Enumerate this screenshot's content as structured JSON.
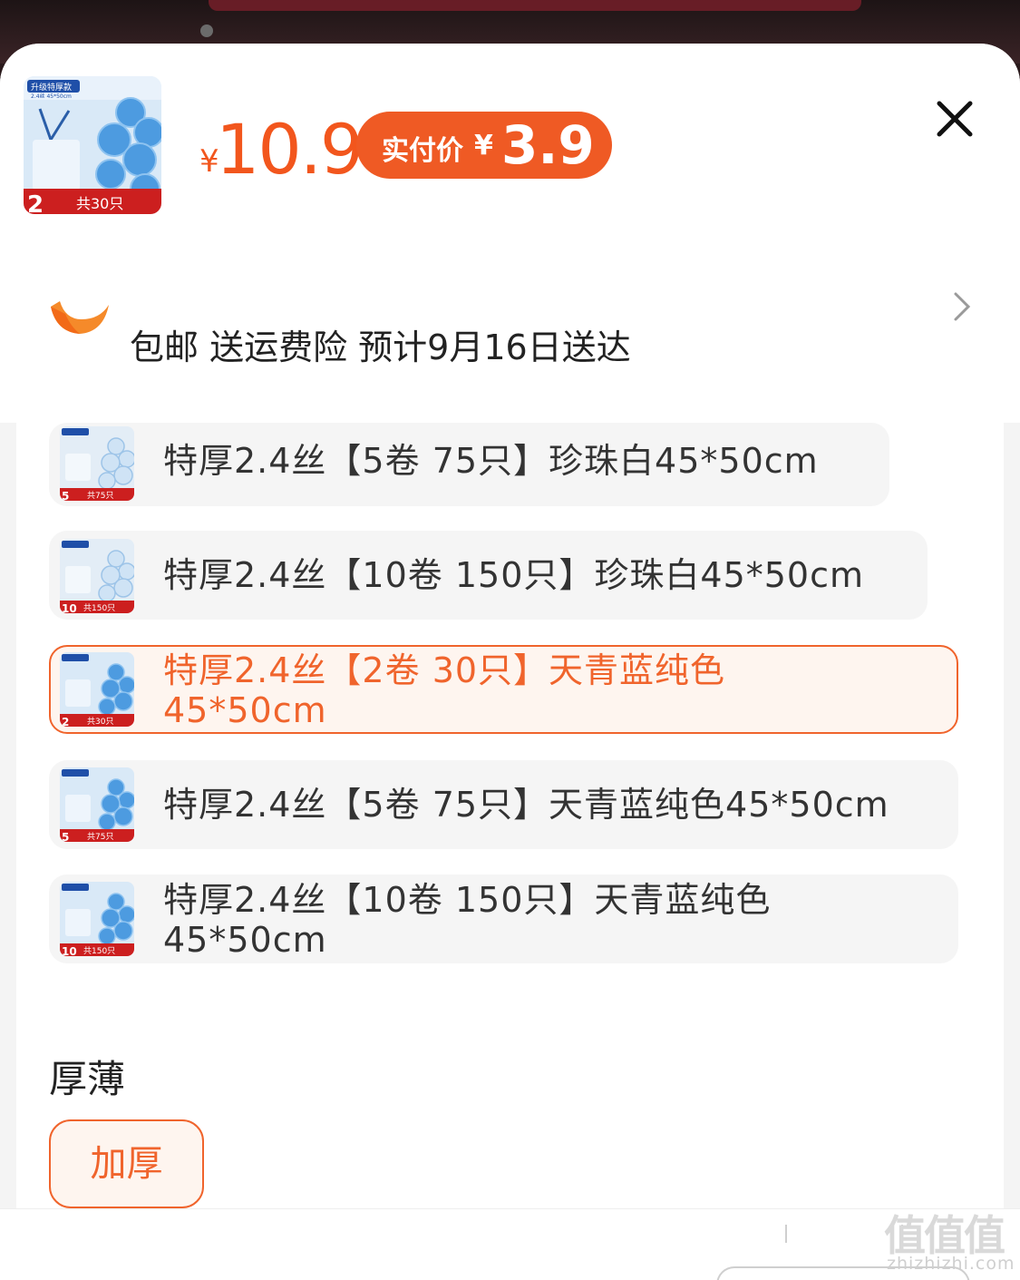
{
  "product": {
    "price_symbol": "¥",
    "price": "10.9",
    "paid_label": "实付价",
    "paid_symbol": "¥",
    "paid_price": "3.9",
    "thumb_badge": "升级特厚款",
    "thumb_spec": "2.4丝 45*50cm",
    "thumb_count": "共30只",
    "thumb_rolls": "2"
  },
  "shipping": {
    "text": "包邮 送运费险 预计9月16日送达"
  },
  "options": [
    {
      "label": "特厚2.4丝【5卷 75只】珍珠白45*50cm",
      "count": "共75只",
      "rolls": "5",
      "selected": false
    },
    {
      "label": "特厚2.4丝【10卷 150只】珍珠白45*50cm",
      "count": "共150只",
      "rolls": "10",
      "selected": false
    },
    {
      "label": "特厚2.4丝【2卷 30只】天青蓝纯色45*50cm",
      "count": "共30只",
      "rolls": "2",
      "selected": true
    },
    {
      "label": "特厚2.4丝【5卷 75只】天青蓝纯色45*50cm",
      "count": "共75只",
      "rolls": "5",
      "selected": false
    },
    {
      "label": "特厚2.4丝【10卷 150只】天青蓝纯色45*50cm",
      "count": "共150只",
      "rolls": "10",
      "selected": false
    }
  ],
  "thickness": {
    "label": "厚薄",
    "option": "加厚"
  },
  "watermark": {
    "brand": "值值值",
    "site": "zhizhizhi.com"
  },
  "colors": {
    "accent": "#f0642c",
    "price": "#f2561d",
    "bag_blue": "#5aa8ea"
  },
  "icons": {
    "close": "close-icon",
    "shipping": "shipping-logo-icon",
    "chevron": "chevron-right-icon"
  }
}
